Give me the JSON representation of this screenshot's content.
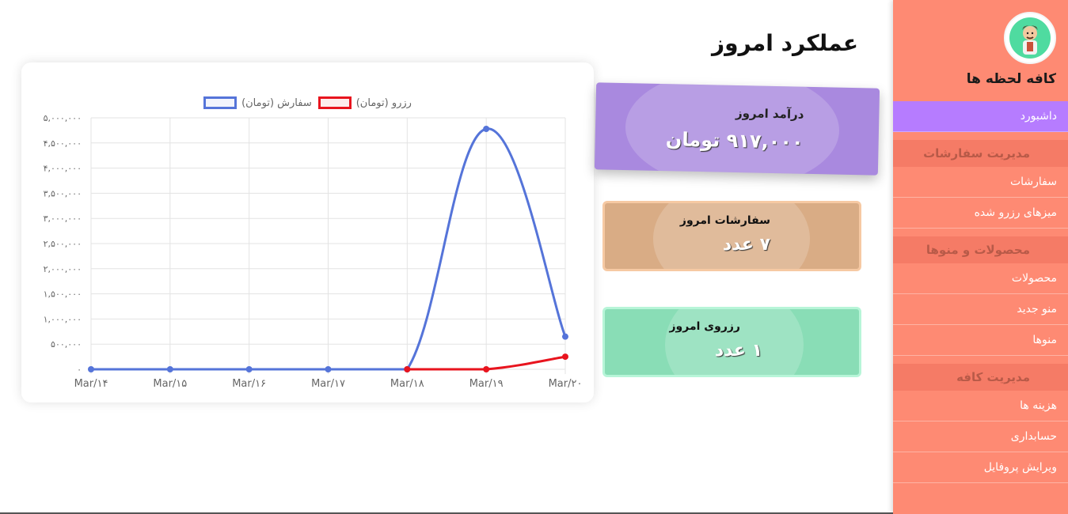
{
  "page_title": "عملکرد امروز",
  "sidebar": {
    "cafe_name": "کافه لحظه ها",
    "items": [
      {
        "type": "item",
        "label": "داشبورد",
        "active": true
      },
      {
        "type": "section",
        "label": "مدیریت سفارشات"
      },
      {
        "type": "item",
        "label": "سفارشات"
      },
      {
        "type": "item",
        "label": "میزهای رزرو شده"
      },
      {
        "type": "section",
        "label": "محصولات و منوها"
      },
      {
        "type": "item",
        "label": "محصولات"
      },
      {
        "type": "item",
        "label": "منو جدید"
      },
      {
        "type": "item",
        "label": "منوها"
      },
      {
        "type": "section",
        "label": "مدیریت کافه"
      },
      {
        "type": "item",
        "label": "هزینه ها"
      },
      {
        "type": "item",
        "label": "حسابداری"
      },
      {
        "type": "item",
        "label": "ویرایش پروفایل"
      }
    ]
  },
  "stats": {
    "revenue": {
      "label": "درآمد امروز",
      "value": "۹۱۷,۰۰۰ تومان"
    },
    "orders": {
      "label": "سفارشات امروز",
      "value": "۷ عدد"
    },
    "reserves": {
      "label": "رزروی امروز",
      "value": "۱ عدد"
    }
  },
  "colors": {
    "sidebar": "#fe8a73",
    "active_item": "#b67cff",
    "revenue_card": "#a989df",
    "orders_card": "#d9ac85",
    "reserves_card": "#89ddb6",
    "orders_series": "#5574d9",
    "reserve_series": "#e8141e"
  },
  "chart_data": {
    "type": "line",
    "categories": [
      "Mar/۱۴",
      "Mar/۱۵",
      "Mar/۱۶",
      "Mar/۱۷",
      "Mar/۱۸",
      "Mar/۱۹",
      "Mar/۲۰"
    ],
    "ylim": [
      0,
      5000000
    ],
    "yticks": [
      0,
      500000,
      1000000,
      1500000,
      2000000,
      2500000,
      3000000,
      3500000,
      4000000,
      4500000,
      5000000
    ],
    "ytick_labels": [
      "۰",
      "۵۰۰,۰۰۰",
      "۱,۰۰۰,۰۰۰",
      "۱,۵۰۰,۰۰۰",
      "۲,۰۰۰,۰۰۰",
      "۲,۵۰۰,۰۰۰",
      "۳,۰۰۰,۰۰۰",
      "۳,۵۰۰,۰۰۰",
      "۴,۰۰۰,۰۰۰",
      "۴,۵۰۰,۰۰۰",
      "۵,۰۰۰,۰۰۰"
    ],
    "grid": true,
    "legend_position": "top",
    "series": [
      {
        "name": "رزرو (تومان)",
        "color": "#e8141e",
        "values": [
          null,
          null,
          null,
          null,
          0,
          0,
          250000
        ]
      },
      {
        "name": "سفارش (تومان)",
        "color": "#5574d9",
        "values": [
          0,
          0,
          0,
          0,
          0,
          4780000,
          650000
        ]
      }
    ]
  }
}
